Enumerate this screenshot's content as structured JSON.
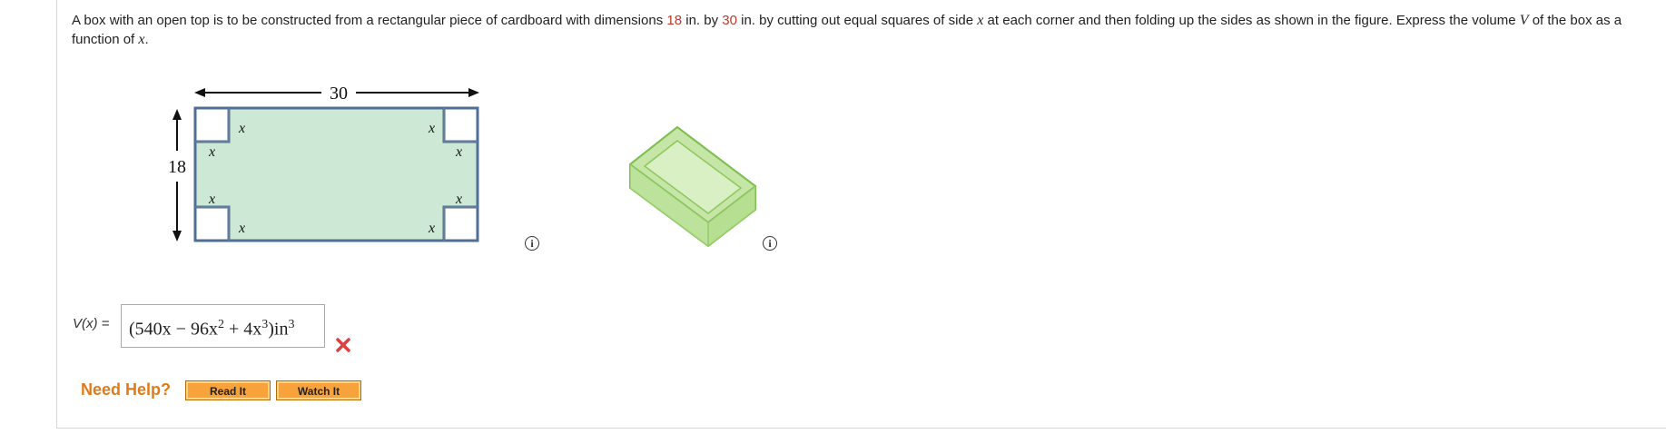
{
  "question": {
    "part1": "A box with an open top is to be constructed from a rectangular piece of cardboard with dimensions ",
    "dim1": "18",
    "part2": " in. by ",
    "dim2": "30",
    "part3": " in. by cutting out equal squares of side ",
    "var_x": "x",
    "part4": " at each corner and then folding up the sides as shown in the figure. Express the volume ",
    "var_v": "V",
    "part5": " of the box as a function of ",
    "var_x2": "x",
    "part6": "."
  },
  "figure": {
    "width_label": "30",
    "height_label": "18",
    "corner_label": "x"
  },
  "info_icon_glyph": "i",
  "answer": {
    "label_prefix": "V(x) =",
    "expr_a": "(540x − 96x",
    "exp_a": "2",
    "expr_b": " + 4x",
    "exp_b": "3",
    "expr_c": ")in",
    "exp_c": "3",
    "status": "incorrect"
  },
  "help": {
    "label": "Need Help?",
    "read_it": "Read It",
    "watch_it": "Watch It"
  },
  "colors": {
    "accent_number": "#c0392b",
    "need_help": "#e07b1a",
    "cardboard_fill": "#cde9d6",
    "cardboard_stroke": "#4f6f96",
    "box_fill": "#c5e6a6",
    "wrong_mark": "#e04040"
  }
}
